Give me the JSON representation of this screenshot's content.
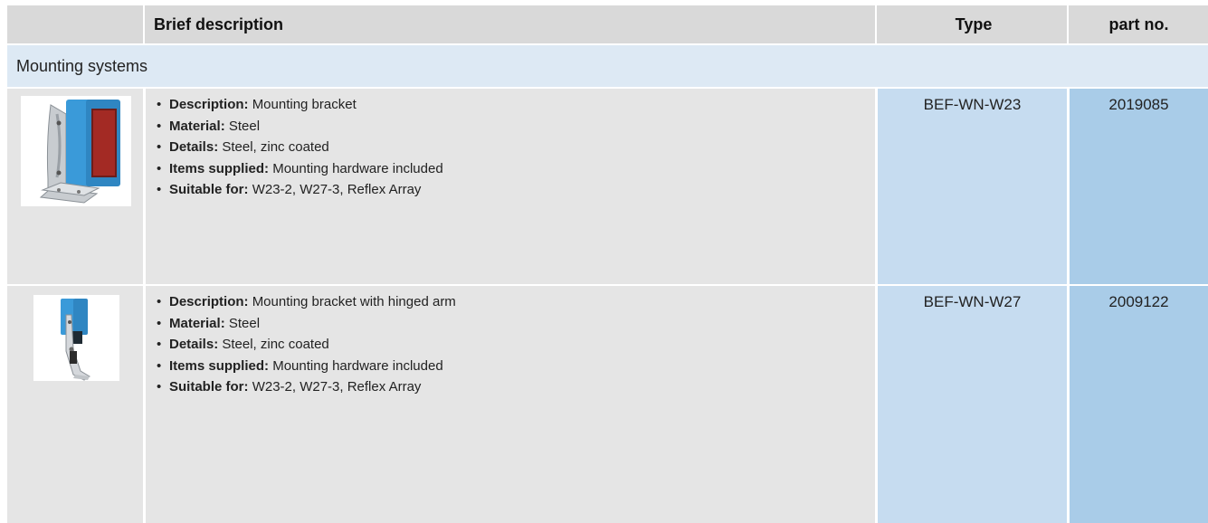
{
  "header": {
    "brief_description": "Brief description",
    "type": "Type",
    "part_no": "part no."
  },
  "section": {
    "title": "Mounting systems"
  },
  "rows": [
    {
      "description": {
        "label": "Description:",
        "value": "Mounting bracket"
      },
      "material": {
        "label": "Material:",
        "value": "Steel"
      },
      "details": {
        "label": "Details:",
        "value": "Steel, zinc coated"
      },
      "items_supplied": {
        "label": "Items supplied:",
        "value": "Mounting hardware included"
      },
      "suitable_for": {
        "label": "Suitable for:",
        "value": "W23-2, W27-3, Reflex Array"
      },
      "type": "BEF-WN-W23",
      "part_no": "2019085"
    },
    {
      "description": {
        "label": "Description:",
        "value": "Mounting bracket with hinged arm"
      },
      "material": {
        "label": "Material:",
        "value": "Steel"
      },
      "details": {
        "label": "Details:",
        "value": "Steel, zinc coated"
      },
      "items_supplied": {
        "label": "Items supplied:",
        "value": "Mounting hardware included"
      },
      "suitable_for": {
        "label": "Suitable for:",
        "value": "W23-2, W27-3, Reflex Array"
      },
      "type": "BEF-WN-W27",
      "part_no": "2009122"
    }
  ],
  "colors": {
    "header_bg": "#d9d9d9",
    "section_bg": "#dde9f4",
    "row_bg": "#e5e5e5",
    "type_bg": "#c6dcf0",
    "part_bg": "#a9cce8",
    "sensor_blue": "#3a9ad9",
    "sensor_red": "#b0342c"
  }
}
